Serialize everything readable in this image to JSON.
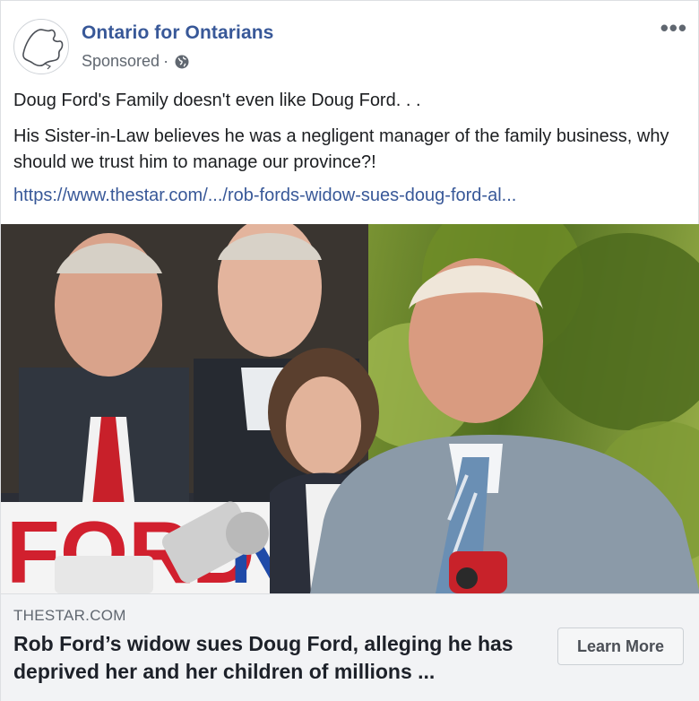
{
  "post": {
    "page_name": "Ontario for Ontarians",
    "sponsored_label": "Sponsored",
    "meta_separator": "·",
    "privacy_icon": "globe-icon",
    "more_icon": "more-options-icon",
    "more_glyph": "•••",
    "text_line1": "Doug Ford's Family doesn't even like Doug Ford. . .",
    "text_line2": "His Sister-in-Law believes he was a negligent manager of the family business, why should we trust him to manage our province?!",
    "link": "https://www.thestar.com/.../rob-fords-widow-sues-doug-ford-al..."
  },
  "photo": {
    "sign_text": "FORD N"
  },
  "link_preview": {
    "domain": "THESTAR.COM",
    "headline": "Rob Ford’s widow sues Doug Ford, alleging he has deprived her and her children of millions ...",
    "cta_label": "Learn More"
  },
  "colors": {
    "link_blue": "#385898",
    "meta_gray": "#606770",
    "footer_bg": "#f2f3f5",
    "sign_red": "#d1202e",
    "sign_blue": "#1f4aa8"
  }
}
